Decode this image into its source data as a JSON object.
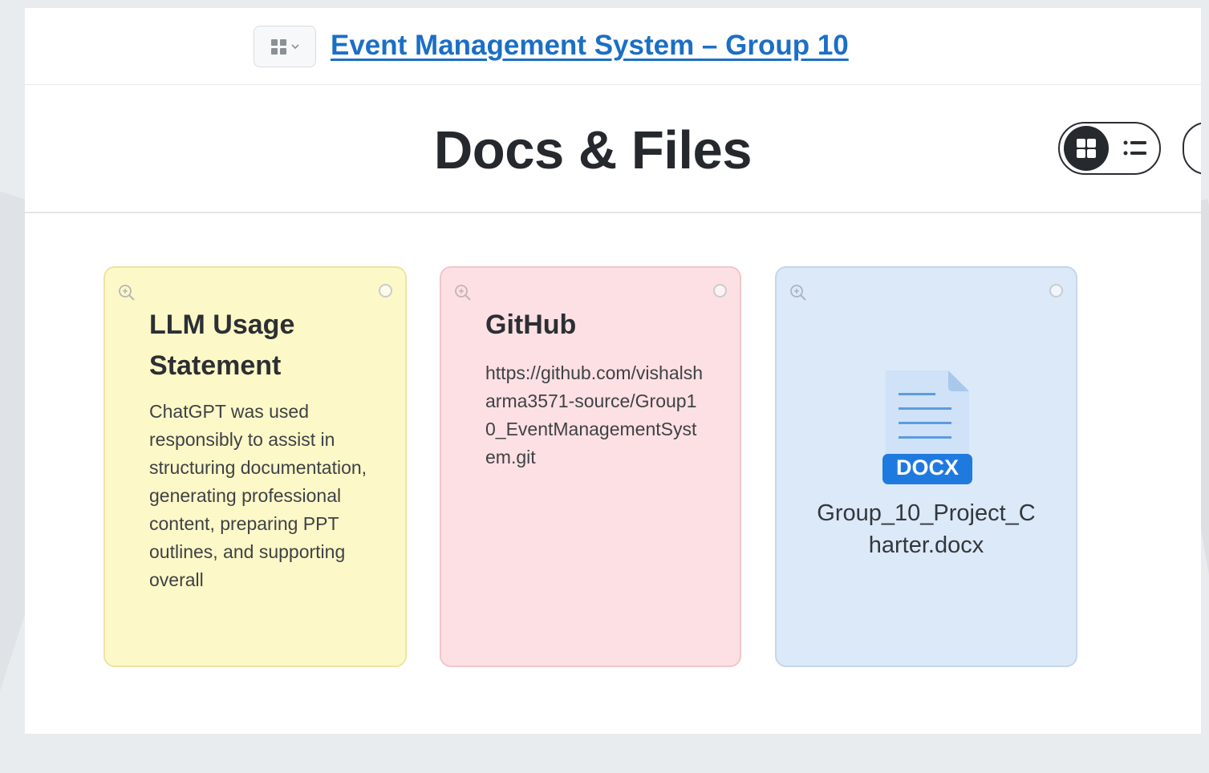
{
  "header": {
    "app_switcher_icon": "apps-grid-icon",
    "breadcrumb_title": "Event Management System – Group 10"
  },
  "page": {
    "title": "Docs & Files",
    "view_toggle": {
      "active": "grid",
      "grid_icon": "grid-view-icon",
      "list_icon": "list-view-icon"
    }
  },
  "cards": [
    {
      "type": "note",
      "color": "#fdf8c7",
      "title": "LLM Usage Statement",
      "body": "ChatGPT was used responsibly to assist in structuring documentation, generating professional content, preparing PPT outlines, and supporting overall"
    },
    {
      "type": "note",
      "color": "#fde0e3",
      "title": "GitHub",
      "body": "https://github.com/vishalsharma3571-source/Group10_EventManagementSystem.git"
    },
    {
      "type": "file",
      "color": "#dbe9f8",
      "file_badge": "DOCX",
      "file_name": "Group_10_Project_Charter.docx"
    }
  ],
  "colors": {
    "link": "#1b6fc5",
    "docx_badge": "#1f7ae0",
    "toggle_dark": "#26292d"
  }
}
